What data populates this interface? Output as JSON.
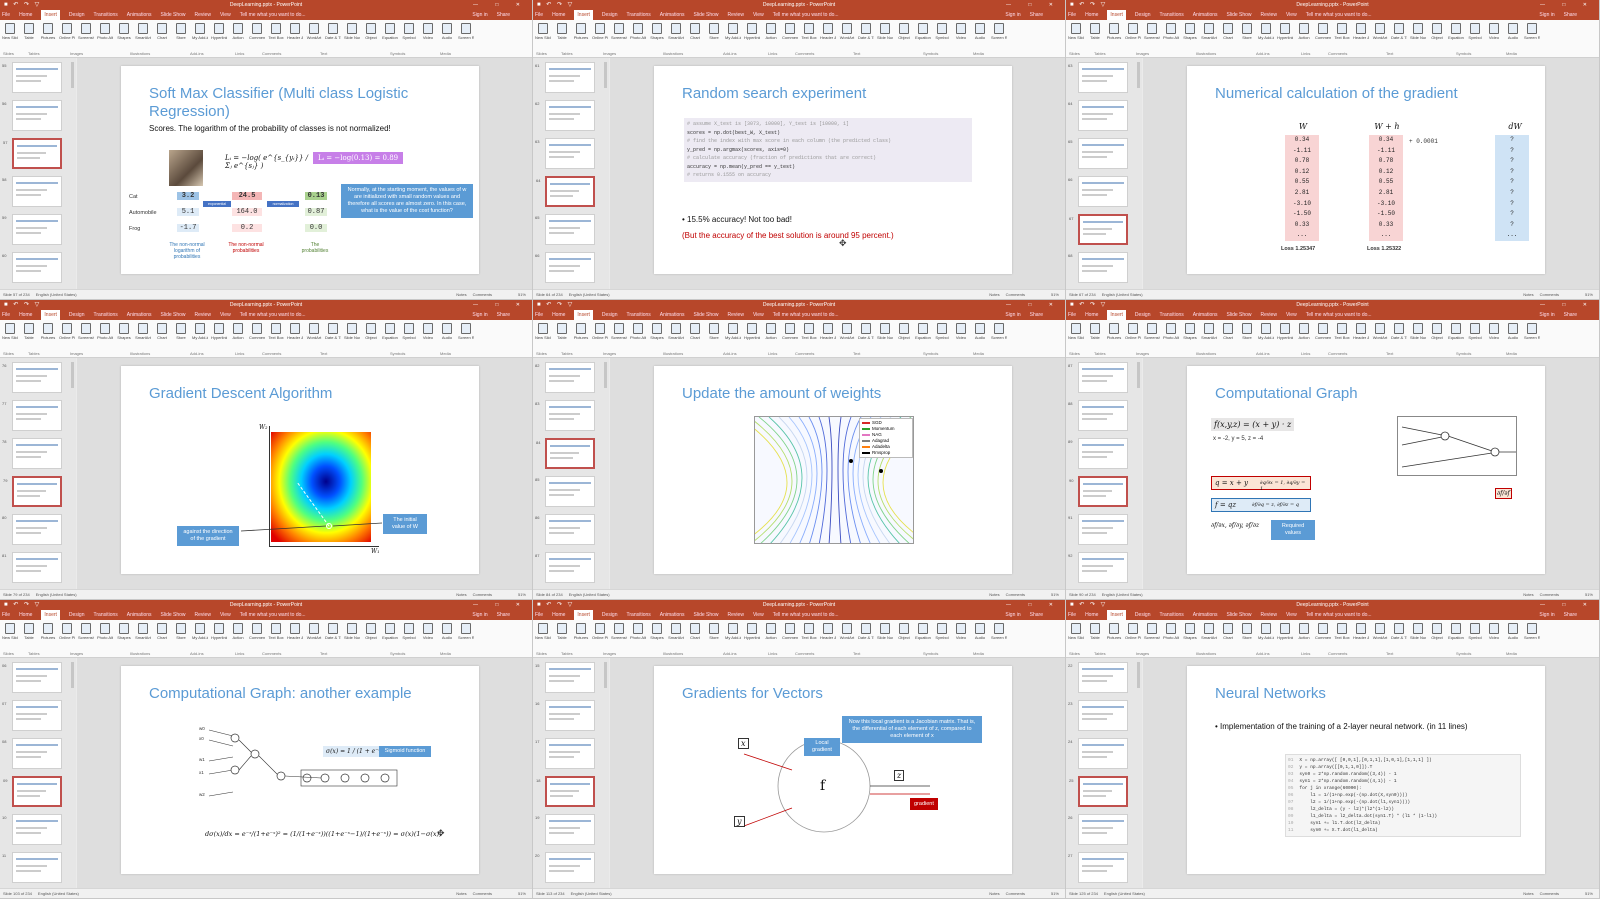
{
  "app": {
    "title": "DeepLearning.pptx - PowerPoint",
    "tabs": [
      "File",
      "Home",
      "Insert",
      "Design",
      "Transitions",
      "Animations",
      "Slide Show",
      "Review",
      "View"
    ],
    "active_tab": "Insert",
    "tell_me": "Tell me what you want to do...",
    "sign_in": "Sign in",
    "share": "Share",
    "quick_access": "■ ↶ ↷ ▽",
    "window_controls": "— □ ✕",
    "ribbon_buttons": [
      "New Slide",
      "Table",
      "Pictures",
      "Online Pictures",
      "Screenshot",
      "Photo Album",
      "Shapes",
      "SmartArt",
      "Chart",
      "Store",
      "My Add-ins",
      "Hyperlink",
      "Action",
      "Comment",
      "Text Box",
      "Header & Footer",
      "WordArt",
      "Date & Time",
      "Slide Number",
      "Object",
      "Equation",
      "Symbol",
      "Video",
      "Audio",
      "Screen Recording"
    ],
    "ribbon_groups": [
      "Slides",
      "Tables",
      "Images",
      "Illustrations",
      "Add-ins",
      "Links",
      "Comments",
      "Text",
      "Symbols",
      "Media"
    ],
    "language": "English (United States)",
    "notes_label": "Notes",
    "comments_label": "Comments",
    "zoom": "51%"
  },
  "panels": [
    {
      "slide_counter": "Slide 57 of 234",
      "thumb_numbers": [
        "55",
        "56",
        "57",
        "58",
        "59",
        "60"
      ],
      "selected_thumb": 2,
      "title": "Soft Max Classifier (Multi class Logistic Regression)",
      "body": "Scores. The logarithm of the probability of classes is not normalized!",
      "formula": "Lᵢ = −log( e^{s_{yᵢ}} / Σⱼ e^{sⱼ} )",
      "highlight_formula": "Lᵢ = −log(0.13) = 0.89",
      "classes": [
        "Cat",
        "Automobile",
        "Frog"
      ],
      "scores": [
        "3.2",
        "5.1",
        "-1.7"
      ],
      "exp_values": [
        "24.5",
        "164.0",
        "0.2"
      ],
      "probs": [
        "0.13",
        "0.87",
        "0.0"
      ],
      "arrow1_label": "exponential",
      "arrow2_label": "normalization",
      "caption1": "The non-normal logarithm of probabilities",
      "caption2": "The non-normal probabilities",
      "caption3": "The probabilities",
      "callout": "Normally, at the starting moment, the values of w are initialized with small random values and therefore all scores are almost zero. In this case, what is the value of the cost function?"
    },
    {
      "slide_counter": "Slide 64 of 234",
      "thumb_numbers": [
        "61",
        "62",
        "63",
        "64",
        "65",
        "66"
      ],
      "selected_thumb": 3,
      "title": "Random search experiment",
      "code": [
        "# assume X_test is [3073, 10000], Y_test is [10000, 1]",
        "scores = np.dot(best_W, X_test)",
        "# find the index with max score in each column (the predicted class)",
        "y_pred = np.argmax(scores, axis=0)",
        "# calculate accuracy (fraction of predictions that are correct)",
        "accuracy = np.mean(y_pred == y_test)",
        "# returns 0.1555 on accuracy"
      ],
      "bullet": "• 15.5% accuracy! Not too bad!",
      "red_note": "(But the accuracy of the best solution is around 95 percent.)"
    },
    {
      "slide_counter": "Slide 67 of 234",
      "thumb_numbers": [
        "63",
        "64",
        "65",
        "66",
        "67",
        "68"
      ],
      "selected_thumb": 4,
      "title": "Numerical calculation of the gradient",
      "col_headers": [
        "W",
        "W + h",
        "dW"
      ],
      "w_values": [
        "0.34",
        "-1.11",
        "0.78",
        "0.12",
        "0.55",
        "2.81",
        "-3.10",
        "-1.50",
        "0.33",
        "..."
      ],
      "wh_values": [
        "0.34",
        "-1.11",
        "0.78",
        "0.12",
        "0.55",
        "2.81",
        "-3.10",
        "-1.50",
        "0.33",
        "..."
      ],
      "dw_values": [
        "?",
        "?",
        "?",
        "?",
        "?",
        "?",
        "?",
        "?",
        "?",
        "..."
      ],
      "h_note": "+ 0.0001",
      "loss1": "Loss 1.25347",
      "loss2": "Loss 1.25322"
    },
    {
      "slide_counter": "Slide 79 of 234",
      "thumb_numbers": [
        "76",
        "77",
        "78",
        "79",
        "80",
        "81"
      ],
      "selected_thumb": 3,
      "title": "Gradient Descent Algorithm",
      "axis_y": "W₂",
      "axis_x": "W₁",
      "callout_left": "against the direction of the gradient",
      "callout_right": "The initial value of W"
    },
    {
      "slide_counter": "Slide 84 of 234",
      "thumb_numbers": [
        "82",
        "83",
        "84",
        "85",
        "86",
        "87"
      ],
      "selected_thumb": 2,
      "title": "Update the amount of weights",
      "legend": [
        {
          "name": "SGD",
          "color": "#d62728"
        },
        {
          "name": "Momentum",
          "color": "#2ca02c"
        },
        {
          "name": "NAG",
          "color": "#e377c2"
        },
        {
          "name": "Adagrad",
          "color": "#7f7f7f"
        },
        {
          "name": "Adadelta",
          "color": "#ff7f0e"
        },
        {
          "name": "Rmsprop",
          "color": "#000000"
        }
      ]
    },
    {
      "slide_counter": "Slide 90 of 234",
      "thumb_numbers": [
        "87",
        "88",
        "89",
        "90",
        "91",
        "92"
      ],
      "selected_thumb": 3,
      "title": "Computational Graph",
      "function": "f(x,y,z) = (x + y) · z",
      "values": "x = -2, y = 5, z = -4",
      "eq_q": "q = x + y",
      "eq_q_grad": "∂q/∂x = 1, ∂q/∂y = 1",
      "eq_f": "f = qz",
      "eq_f_grad": "∂f/∂q = z, ∂f/∂z = q",
      "required": "∂f/∂x, ∂f/∂y, ∂f/∂z",
      "required_label": "Required values",
      "graph_out": "∂f/∂f"
    },
    {
      "slide_counter": "Slide 103 of 234",
      "thumb_numbers": [
        "06",
        "07",
        "08",
        "09",
        "10",
        "11"
      ],
      "selected_thumb": 3,
      "title": "Computational Graph: another example",
      "sigmoid_formula": "σ(x) = 1 / (1 + e⁻ˣ)",
      "sigmoid_label": "Sigmoid function",
      "inputs": [
        "w0",
        "x0",
        "w1",
        "x1",
        "w2"
      ],
      "derivative": "dσ(x)/dx = e⁻ˣ/(1+e⁻ˣ)² = (1/(1+e⁻ˣ))((1+e⁻ˣ−1)/(1+e⁻ˣ)) = σ(x)(1−σ(x))"
    },
    {
      "slide_counter": "Slide 113 of 234",
      "thumb_numbers": [
        "15",
        "16",
        "17",
        "18",
        "19",
        "20"
      ],
      "selected_thumb": 3,
      "title": "Gradients for Vectors",
      "callout": "Now this local gradient is a Jacobian matrix. That is, the differential of each element of z, compared to each element of x",
      "local_label": "Local gradient",
      "grad_label": "gradient",
      "node": "f",
      "var_x": "x",
      "var_y": "y",
      "var_z": "z"
    },
    {
      "slide_counter": "Slide 125 of 234",
      "thumb_numbers": [
        "22",
        "23",
        "24",
        "25",
        "26",
        "27"
      ],
      "selected_thumb": 3,
      "title": "Neural Networks",
      "bullet": "• Implementation of the training of a 2-layer neural network. (in 11 lines)",
      "code": [
        "X = np.array([ [0,0,1],[0,1,1],[1,0,1],[1,1,1] ])",
        "y = np.array([[0,1,1,0]]).T",
        "syn0 = 2*np.random.random((3,4)) - 1",
        "syn1 = 2*np.random.random((4,1)) - 1",
        "for j in xrange(60000):",
        "    l1 = 1/(1+np.exp(-(np.dot(X,syn0))))",
        "    l2 = 1/(1+np.exp(-(np.dot(l1,syn1))))",
        "    l2_delta = (y - l2)*(l2*(1-l2))",
        "    l1_delta = l2_delta.dot(syn1.T) * (l1 * (1-l1))",
        "    syn1 += l1.T.dot(l2_delta)",
        "    syn0 += X.T.dot(l1_delta)"
      ],
      "line_numbers": [
        "01",
        "02",
        "03",
        "04",
        "05",
        "06",
        "07",
        "08",
        "09",
        "10",
        "11"
      ]
    }
  ]
}
